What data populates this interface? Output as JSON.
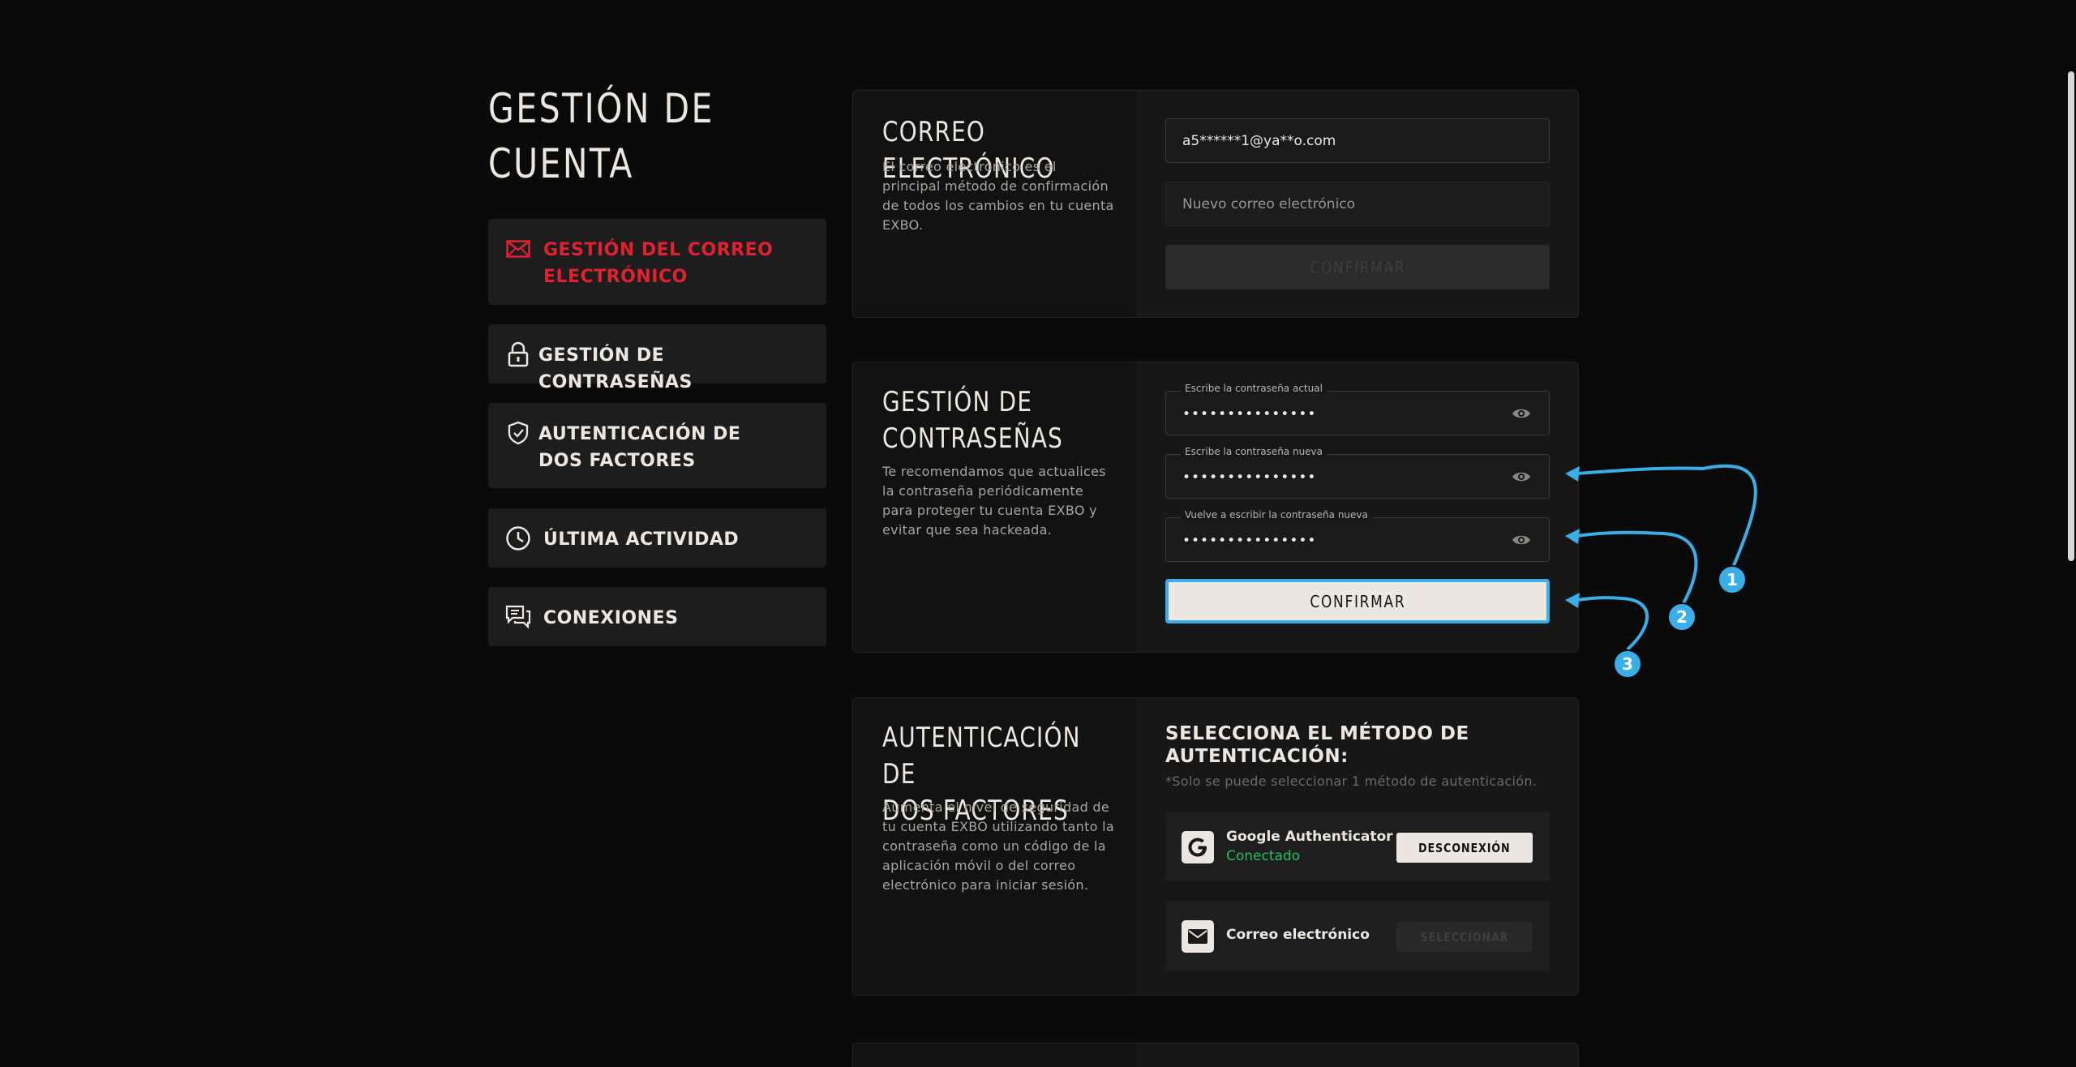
{
  "sidebar": {
    "title": "GESTIÓN DE\nCUENTA",
    "items": [
      {
        "label": "GESTIÓN DEL CORREO ELECTRÓNICO",
        "icon": "envelope-icon",
        "active": true
      },
      {
        "label": "GESTIÓN DE CONTRASEÑAS",
        "icon": "lock-icon"
      },
      {
        "label": "AUTENTICACIÓN DE DOS FACTORES",
        "icon": "shield-check-icon"
      },
      {
        "label": "ÚLTIMA ACTIVIDAD",
        "icon": "clock-icon"
      },
      {
        "label": "CONEXIONES",
        "icon": "chat-bubbles-icon"
      }
    ]
  },
  "email_card": {
    "title": "CORREO ELECTRÓNICO",
    "description": "El correo electrónico es el principal método de confirmación de todos los cambios en tu cuenta EXBO.",
    "current_email": "a5******1@ya**o.com",
    "new_email_placeholder": "Nuevo correo electrónico",
    "confirm_label": "CONFIRMAR"
  },
  "password_card": {
    "title": "GESTIÓN DE\nCONTRASEÑAS",
    "description": "Te recomendamos que actualices la contraseña periódicamente para proteger tu cuenta EXBO y evitar que sea hackeada.",
    "fields": [
      {
        "label": "Escribe la contraseña actual",
        "value": "•••••••••••••••"
      },
      {
        "label": "Escribe la contraseña nueva",
        "value": "•••••••••••••••"
      },
      {
        "label": "Vuelve a escribir la contraseña nueva",
        "value": "•••••••••••••••"
      }
    ],
    "confirm_label": "CONFIRMAR"
  },
  "twofa_card": {
    "title": "AUTENTICACIÓN DE\nDOS FACTORES",
    "description": "Aumenta el nivel de seguridad de tu cuenta EXBO utilizando tanto la contraseña como un código de la aplicación móvil o del correo electrónico para iniciar sesión.",
    "heading": "SELECCIONA EL MÉTODO DE AUTENTICACIÓN:",
    "note": "*Solo se puede seleccionar 1 método de autenticación.",
    "methods": [
      {
        "name": "Google Authenticator",
        "status": "Conectado",
        "action": "DESCONEXIÓN",
        "icon": "google-g-icon"
      },
      {
        "name": "Correo electrónico",
        "status": "",
        "action": "SELECCIONAR",
        "icon": "envelope-icon"
      }
    ]
  },
  "annotations": {
    "badges": [
      "1",
      "2",
      "3"
    ],
    "color": "#3aaee8"
  },
  "colors": {
    "accent_red": "#e0212f",
    "success_green": "#21c25e",
    "light": "#ece7e1",
    "background": "#0a0a0a"
  }
}
